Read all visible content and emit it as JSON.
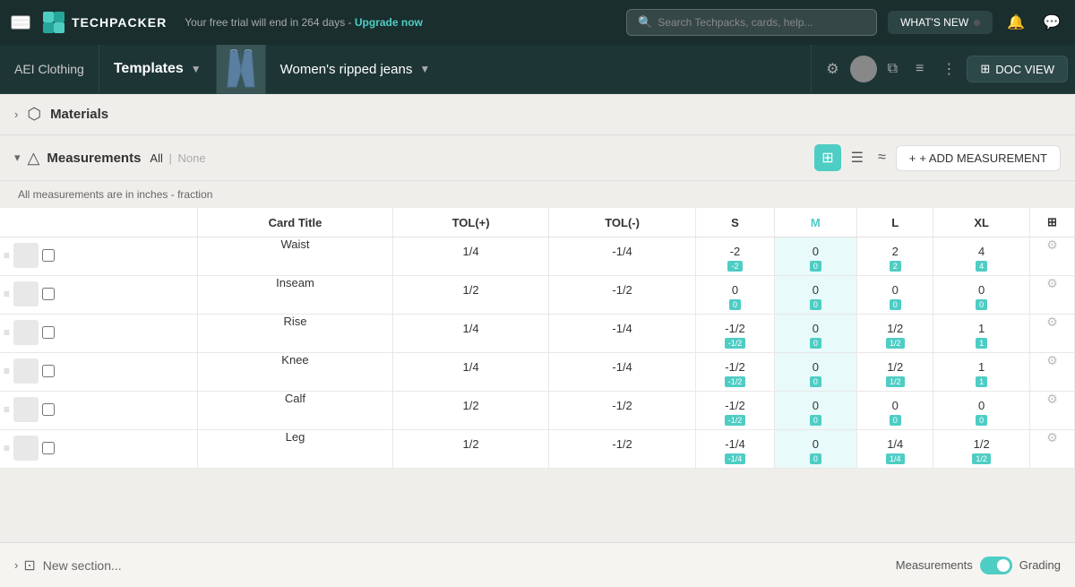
{
  "topNav": {
    "menuLabel": "menu",
    "logoText": "TECHPACKER",
    "trialText": "Your free trial will end in 264 days -",
    "upgradeText": "Upgrade now",
    "searchPlaceholder": "Search Techpacks, cards, help...",
    "whatsNewLabel": "WHAT'S NEW",
    "searchIcon": "🔍"
  },
  "secondNav": {
    "brandLabel": "AEI Clothing",
    "templatesLabel": "Templates",
    "productName": "Women's ripped jeans",
    "docViewLabel": "DOC VIEW",
    "layersIcon": "⊞"
  },
  "sections": {
    "materials": {
      "title": "Materials",
      "icon": "⬡"
    },
    "measurements": {
      "title": "Measurements",
      "filterAll": "All",
      "filterSep": "|",
      "filterNone": "None",
      "infoText": "All measurements are in inches - fraction",
      "addBtnLabel": "+ ADD MEASUREMENT"
    }
  },
  "table": {
    "headers": [
      "",
      "Card Title",
      "TOL(+)",
      "TOL(-)",
      "S",
      "M",
      "L",
      "XL",
      ""
    ],
    "rows": [
      {
        "name": "Waist",
        "tol_plus": "1/4",
        "tol_minus": "-1/4",
        "s": "-2",
        "s_tag": "-2",
        "m": "0",
        "m_tag": "0",
        "l": "2",
        "l_tag": "2",
        "xl": "4",
        "xl_tag": "4"
      },
      {
        "name": "Inseam",
        "tol_plus": "1/2",
        "tol_minus": "-1/2",
        "s": "0",
        "s_tag": "0",
        "m": "0",
        "m_tag": "0",
        "l": "0",
        "l_tag": "0",
        "xl": "0",
        "xl_tag": "0"
      },
      {
        "name": "Rise",
        "tol_plus": "1/4",
        "tol_minus": "-1/4",
        "s": "-1/2",
        "s_tag": "-1/2",
        "m": "0",
        "m_tag": "0",
        "l": "1/2",
        "l_tag": "1/2",
        "xl": "1",
        "xl_tag": "1"
      },
      {
        "name": "Knee",
        "tol_plus": "1/4",
        "tol_minus": "-1/4",
        "s": "-1/2",
        "s_tag": "-1/2",
        "m": "0",
        "m_tag": "0",
        "l": "1/2",
        "l_tag": "1/2",
        "xl": "1",
        "xl_tag": "1"
      },
      {
        "name": "Calf",
        "tol_plus": "1/2",
        "tol_minus": "-1/2",
        "s": "-1/2",
        "s_tag": "-1/2",
        "m": "0",
        "m_tag": "0",
        "l": "0",
        "l_tag": "0",
        "xl": "0",
        "xl_tag": "0"
      },
      {
        "name": "Leg",
        "tol_plus": "1/2",
        "tol_minus": "-1/2",
        "s": "-1/4",
        "s_tag": "-1/4",
        "m": "0",
        "m_tag": "0",
        "l": "1/4",
        "l_tag": "1/4",
        "xl": "1/2",
        "xl_tag": "1/2"
      }
    ]
  },
  "bottomBar": {
    "newSectionLabel": "New section...",
    "measurementsLabel": "Measurements",
    "gradingLabel": "Grading"
  }
}
